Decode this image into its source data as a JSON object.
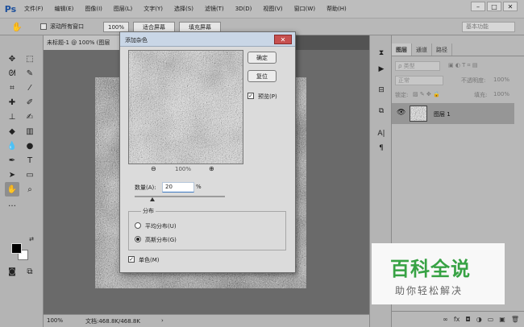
{
  "app": {
    "logo": "Ps"
  },
  "menu": [
    "文件(F)",
    "编辑(E)",
    "图像(I)",
    "图层(L)",
    "文字(Y)",
    "选择(S)",
    "滤镜(T)",
    "3D(D)",
    "视图(V)",
    "窗口(W)",
    "帮助(H)"
  ],
  "window_buttons": {
    "minimize": "–",
    "maximize": "□",
    "close": "✕"
  },
  "options_bar": {
    "scroll_all_label": "滚动所有窗口",
    "zoom_value": "100%",
    "fit_screen_label": "适合屏幕",
    "fill_screen_label": "填充屏幕",
    "workspace": "基本功能"
  },
  "document": {
    "tab_title": "未标题-1 @ 100% (图层",
    "status_zoom": "100%",
    "status_doc": "文档:468.8K/468.8K"
  },
  "layers_panel": {
    "tabs": [
      "图层",
      "通道",
      "路径"
    ],
    "filter_kind": "ρ 类型",
    "blend_mode": "正常",
    "opacity_label": "不透明度:",
    "opacity_value": "100%",
    "lock_label": "锁定:",
    "fill_label": "填充:",
    "fill_value": "100%",
    "layer_name": "图层 1",
    "bottom_icons": [
      "∞",
      "fx",
      "◘",
      "◑",
      "▭",
      "▣",
      "🗑"
    ]
  },
  "dialog": {
    "title": "添加杂色",
    "ok_label": "确定",
    "reset_label": "复位",
    "preview_label": "预览(P)",
    "preview_checked": true,
    "zoom_percent": "100%",
    "amount_label": "数量(A):",
    "amount_value": "20",
    "amount_unit": "%",
    "amount_slider_fraction": 0.2,
    "distribution_label": "分布",
    "uniform_label": "平均分布(U)",
    "gaussian_label": "高斯分布(G)",
    "selected_distribution": "gaussian",
    "mono_label": "单色(M)",
    "mono_checked": true
  },
  "watermark": {
    "main": "百科全说",
    "sub": "助你轻松解决"
  },
  "colors": {
    "accent": "#37a244",
    "dialog_title_bg": "#c9d6e6",
    "close_red": "#c75050"
  }
}
